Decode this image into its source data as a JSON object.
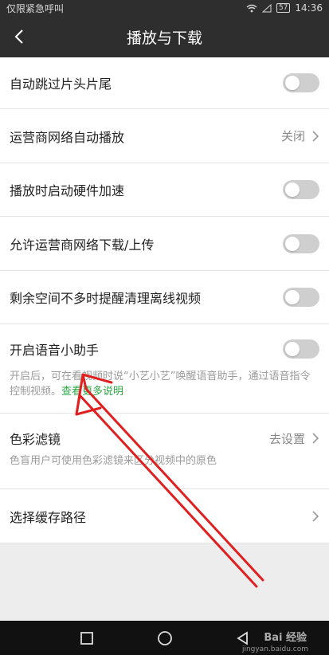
{
  "status_bar": {
    "carrier": "仅限紧急呼叫",
    "battery": "57",
    "time": "14:36"
  },
  "header": {
    "title": "播放与下载"
  },
  "settings": {
    "skip_intro": {
      "label": "自动跳过片头片尾"
    },
    "carrier_autoplay": {
      "label": "运营商网络自动播放",
      "value": "关闭"
    },
    "hw_accel": {
      "label": "播放时启动硬件加速"
    },
    "carrier_download": {
      "label": "允许运营商网络下载/上传"
    },
    "storage_reminder": {
      "label": "剩余空间不多时提醒清理离线视频"
    },
    "voice_assistant": {
      "label": "开启语音小助手",
      "desc": "开启后，可在看视频时说“小艺小艺”唤醒语音助手，通过语音指令控制视频。",
      "link": "查看更多说明"
    },
    "color_filter": {
      "label": "色彩滤镜",
      "value": "去设置",
      "desc": "色盲用户可使用色彩滤镜来区分视频中的原色"
    },
    "cache_path": {
      "label": "选择缓存路径"
    }
  },
  "watermark": {
    "logo": "Bai 经验",
    "site": "jingyan.baidu.com"
  },
  "colors": {
    "accent_green": "#2aa944",
    "header_bg": "#2e2e2e",
    "annotation_red": "#e02020"
  }
}
